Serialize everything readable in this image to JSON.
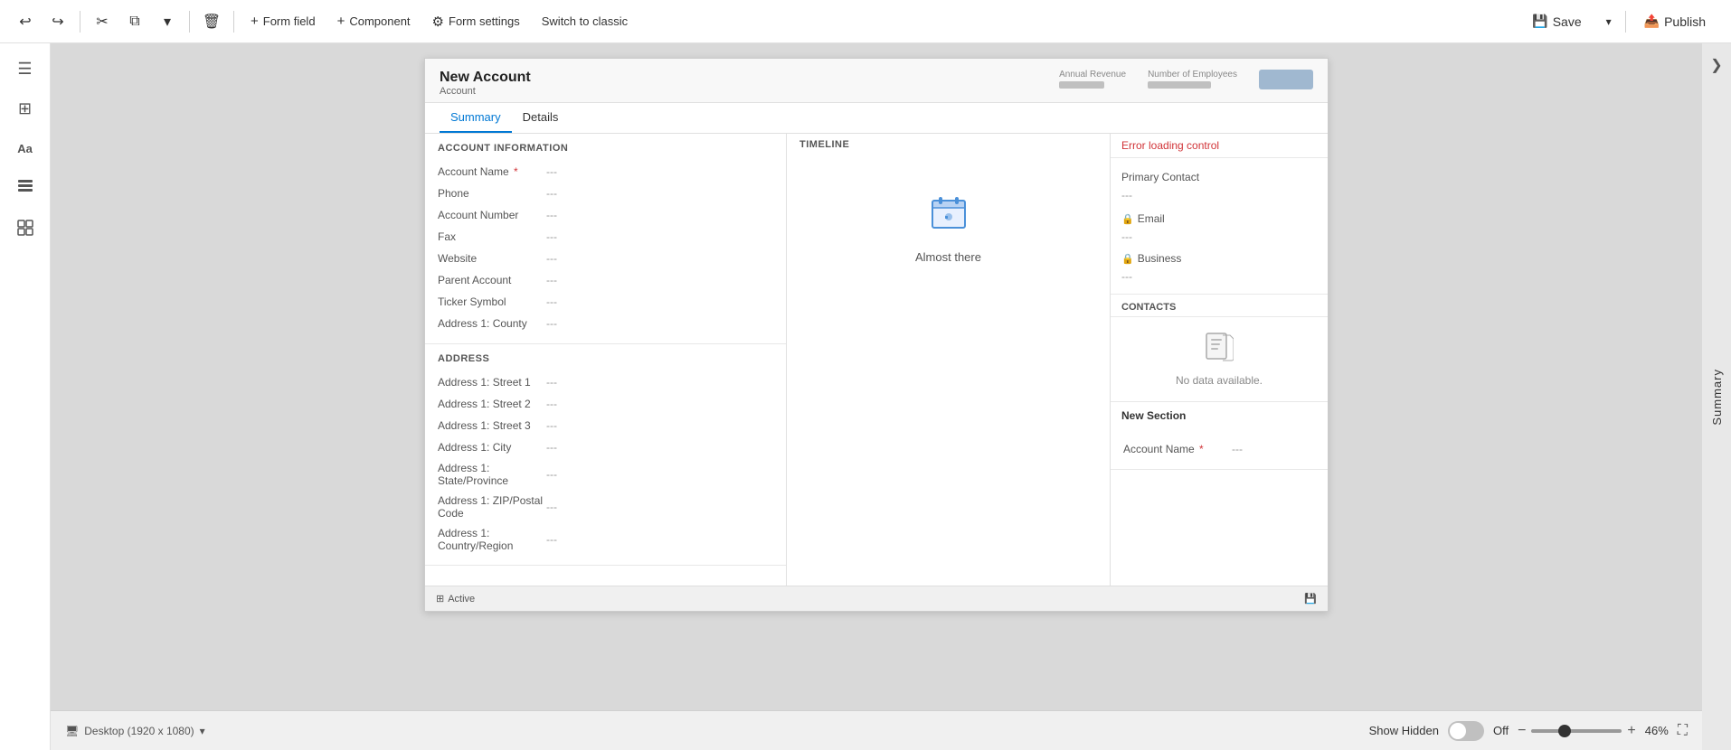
{
  "toolbar": {
    "undo_label": "↩",
    "redo_label": "↪",
    "cut_label": "✂",
    "copy_label": "⧉",
    "dropdown_label": "▾",
    "delete_label": "🗑",
    "form_field_label": "Form field",
    "component_label": "Component",
    "form_settings_label": "Form settings",
    "switch_classic_label": "Switch to classic",
    "save_label": "Save",
    "publish_label": "Publish",
    "save_icon": "💾",
    "publish_icon": "📤"
  },
  "left_sidebar": {
    "items": [
      {
        "icon": "☰",
        "name": "menu-icon"
      },
      {
        "icon": "⊞",
        "name": "grid-icon"
      },
      {
        "icon": "Aa",
        "name": "text-icon"
      },
      {
        "icon": "⧉",
        "name": "layers-icon"
      },
      {
        "icon": "⊟",
        "name": "component-icon"
      }
    ]
  },
  "right_sidebar": {
    "label": "Summary",
    "collapse_icon": "❯"
  },
  "form": {
    "title": "New Account",
    "subtitle": "Account",
    "stat1_label": "Annual Revenue",
    "stat2_label": "Number of Employees",
    "tabs": [
      {
        "label": "Summary",
        "active": true
      },
      {
        "label": "Details",
        "active": false
      }
    ],
    "sections": {
      "account_info": {
        "title": "ACCOUNT INFORMATION",
        "fields": [
          {
            "label": "Account Name",
            "required": true,
            "value": "---"
          },
          {
            "label": "Phone",
            "required": false,
            "value": "---"
          },
          {
            "label": "Account Number",
            "required": false,
            "value": "---"
          },
          {
            "label": "Fax",
            "required": false,
            "value": "---"
          },
          {
            "label": "Website",
            "required": false,
            "value": "---"
          },
          {
            "label": "Parent Account",
            "required": false,
            "value": "---"
          },
          {
            "label": "Ticker Symbol",
            "required": false,
            "value": "---"
          },
          {
            "label": "Address 1: County",
            "required": false,
            "value": "---"
          }
        ]
      },
      "address": {
        "title": "ADDRESS",
        "fields": [
          {
            "label": "Address 1: Street 1",
            "value": "---"
          },
          {
            "label": "Address 1: Street 2",
            "value": "---"
          },
          {
            "label": "Address 1: Street 3",
            "value": "---"
          },
          {
            "label": "Address 1: City",
            "value": "---"
          },
          {
            "label": "Address 1: State/Province",
            "value": "---"
          },
          {
            "label": "Address 1: ZIP/Postal Code",
            "value": "---"
          },
          {
            "label": "Address 1: Country/Region",
            "value": "---"
          }
        ]
      }
    },
    "timeline": {
      "icon": "📁",
      "label": "Almost there",
      "section_label": "Timeline"
    },
    "right_panel": {
      "error_text": "Error loading control",
      "primary_contact_label": "Primary Contact",
      "primary_contact_value": "---",
      "email_label": "Email",
      "email_value": "---",
      "business_label": "Business",
      "business_value": "---",
      "contacts_header": "CONTACTS",
      "no_data_icon": "📄",
      "no_data_text": "No data available.",
      "new_section_label": "New Section",
      "new_section_field": "Account Name",
      "new_section_required": true,
      "new_section_value": "---"
    }
  },
  "bottom_bar": {
    "status_icon": "🖥",
    "status_label": "Active",
    "save_icon": "💾",
    "save_label": "Save",
    "device_label": "Desktop (1920 x 1080)",
    "device_icon": "🖥",
    "dropdown_icon": "▾",
    "show_hidden_label": "Show Hidden",
    "toggle_state": "Off",
    "zoom_minus": "−",
    "zoom_plus": "+",
    "zoom_percent": "46%",
    "fullscreen_icon": "⛶"
  }
}
